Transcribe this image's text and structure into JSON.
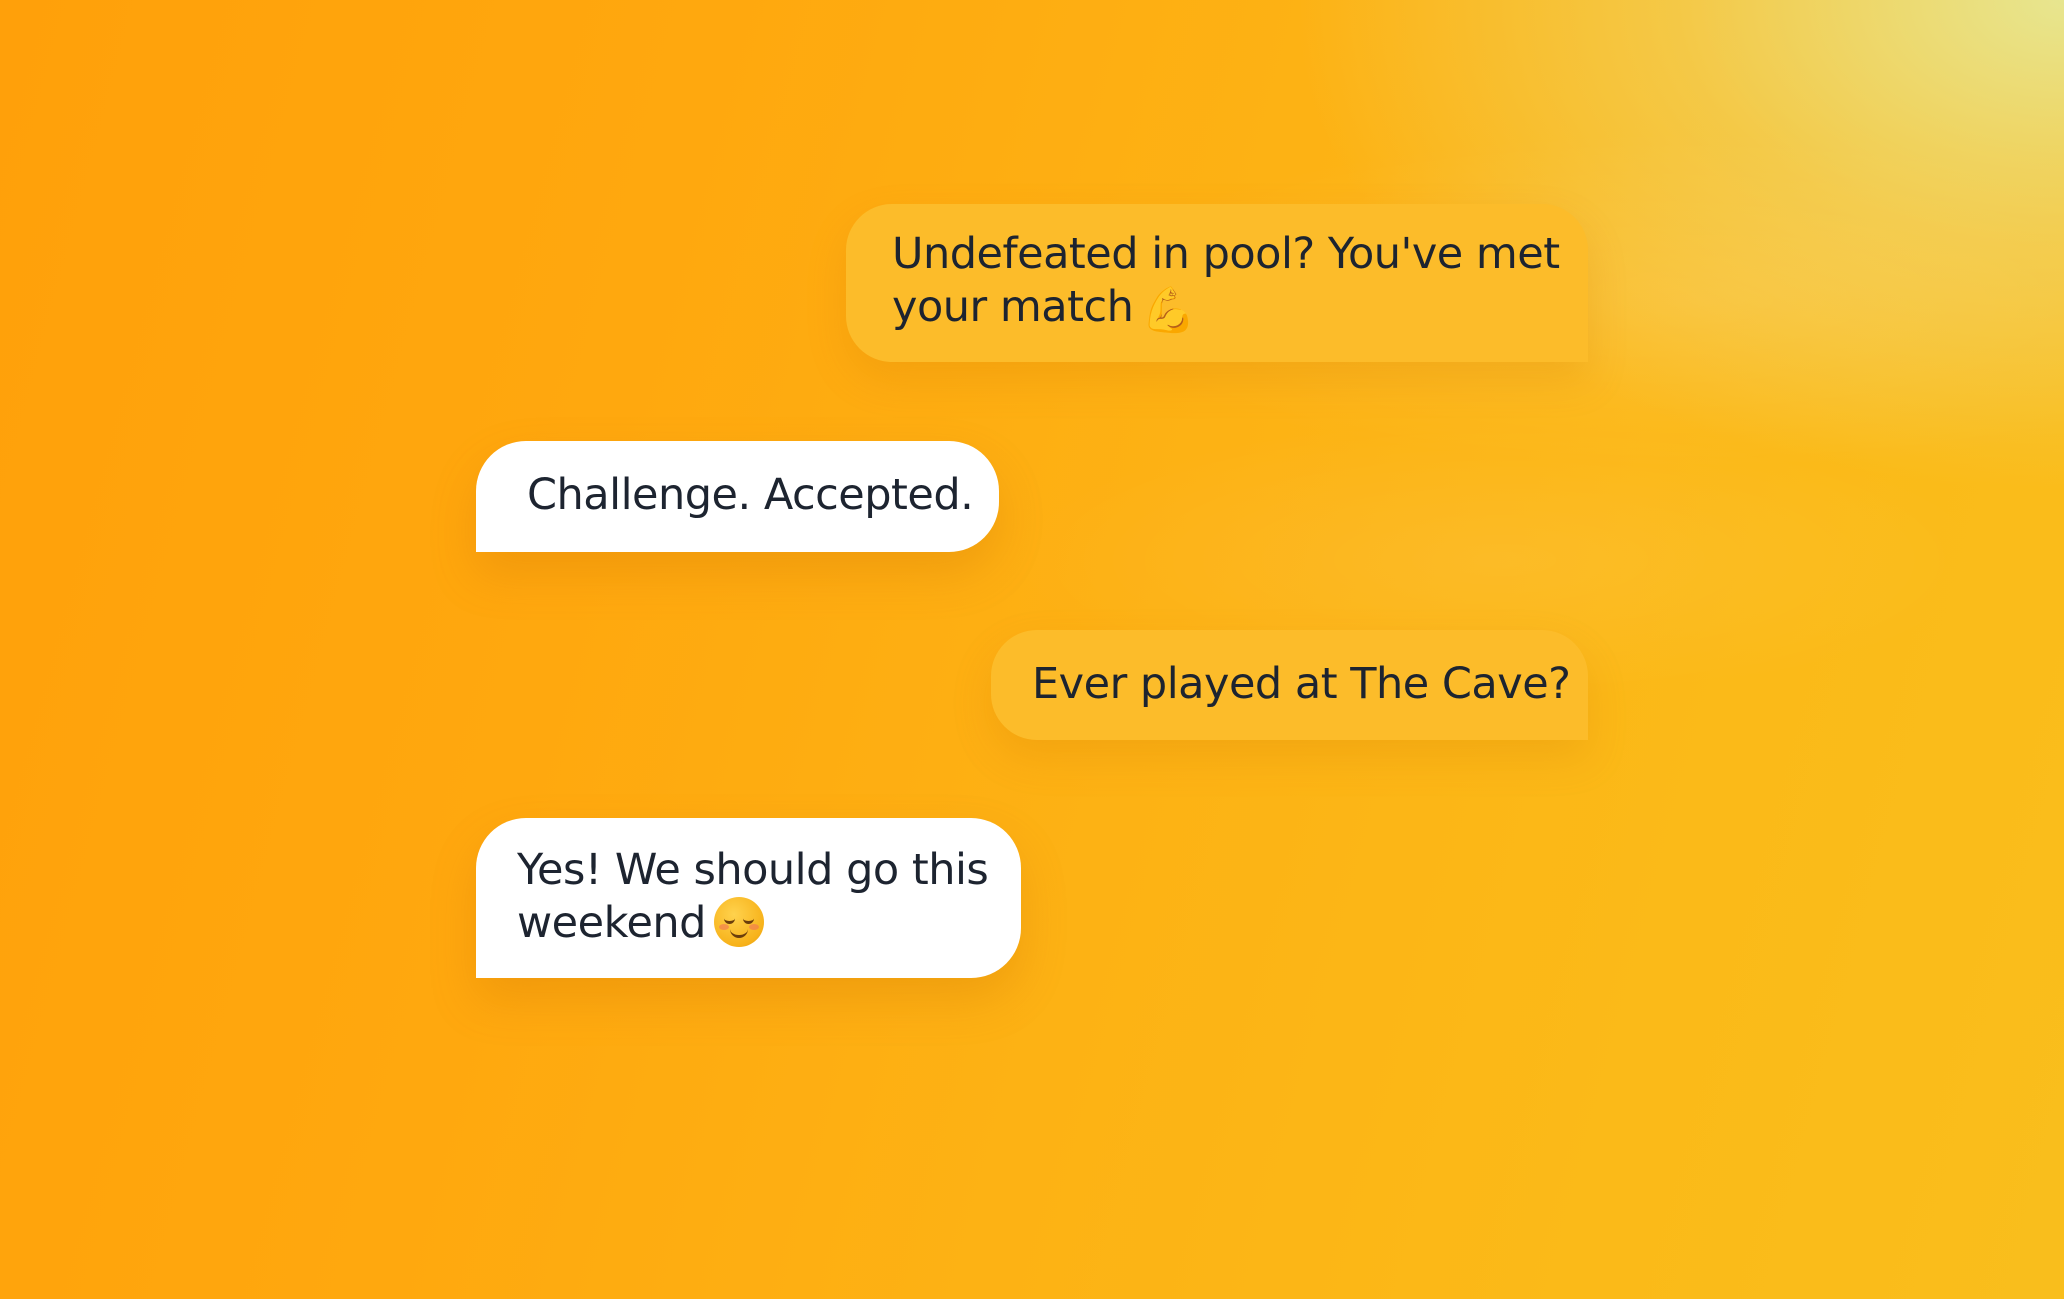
{
  "conversation": {
    "messages": [
      {
        "sender": "me",
        "lines": [
          "Undefeated in pool? You've met",
          "your match"
        ],
        "emoji": "💪",
        "emoji_name": "flexed-biceps-icon"
      },
      {
        "sender": "them",
        "lines": [
          "Challenge. Accepted."
        ]
      },
      {
        "sender": "me",
        "lines": [
          "Ever played at The Cave?"
        ]
      },
      {
        "sender": "them",
        "lines": [
          "Yes! We should go this",
          "weekend"
        ],
        "emoji": "☺",
        "emoji_name": "smiling-face-icon"
      }
    ]
  },
  "colors": {
    "sent_bubble": "#fcbc2a",
    "received_bubble": "#ffffff",
    "text": "#1d2430",
    "background_start": "#ffa00a",
    "background_end": "#e8e68f"
  }
}
